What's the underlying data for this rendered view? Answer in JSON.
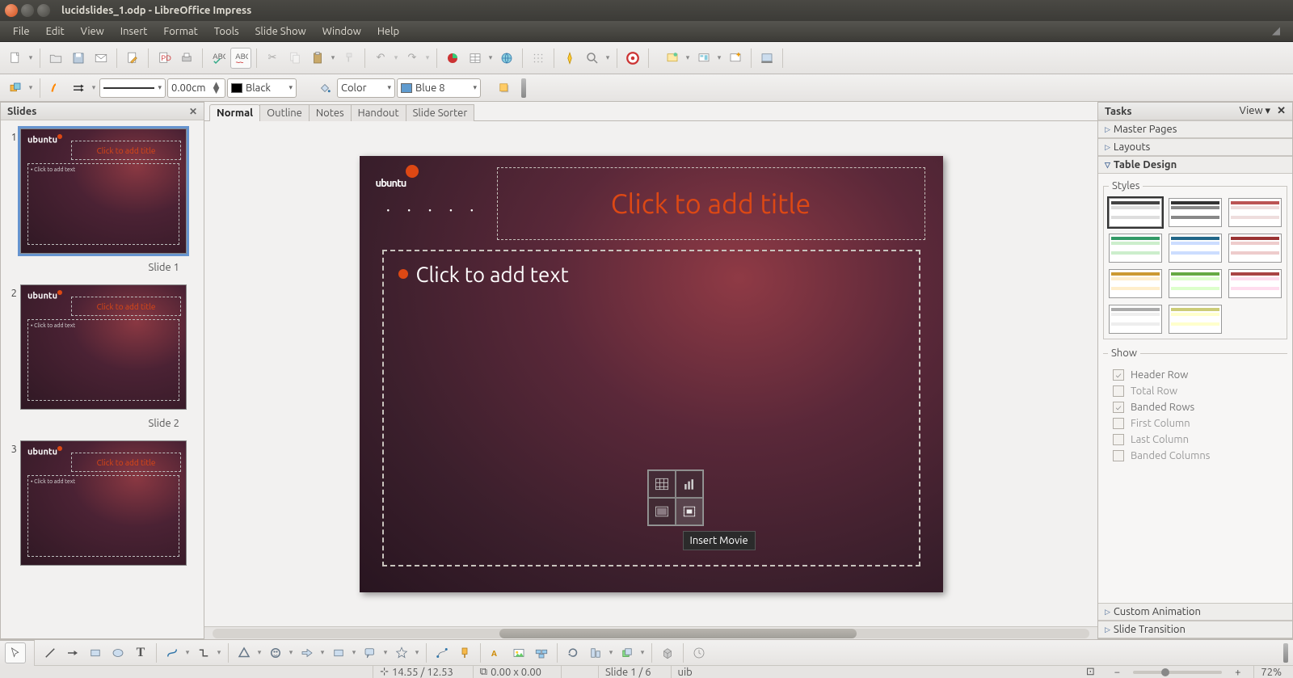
{
  "window": {
    "title": "lucidslides_1.odp - LibreOffice Impress"
  },
  "menu": [
    "File",
    "Edit",
    "View",
    "Insert",
    "Format",
    "Tools",
    "Slide Show",
    "Window",
    "Help"
  ],
  "fmt": {
    "width": "0.00cm",
    "linecolor": "Black",
    "fillmode": "Color",
    "fillcolor": "Blue 8"
  },
  "slides_panel": {
    "title": "Slides",
    "slides": [
      {
        "num": "1",
        "label": "Slide 1",
        "title": "Click to add title",
        "text": "Click to add text",
        "selected": true
      },
      {
        "num": "2",
        "label": "Slide 2",
        "title": "Click to add title",
        "text": "Click to add text",
        "selected": false
      },
      {
        "num": "3",
        "label": "",
        "title": "Click to add title",
        "text": "Click to add text",
        "selected": false
      }
    ]
  },
  "viewtabs": [
    "Normal",
    "Outline",
    "Notes",
    "Handout",
    "Slide Sorter"
  ],
  "slide": {
    "logo": "ubuntu",
    "title_ph": "Click to add title",
    "text_ph": "Click to add text",
    "tooltip": "Insert Movie"
  },
  "tasks": {
    "title": "Tasks",
    "view": "View",
    "sections": {
      "master": "Master Pages",
      "layouts": "Layouts",
      "table": "Table Design",
      "custom": "Custom Animation",
      "trans": "Slide Transition"
    },
    "styles_label": "Styles",
    "show_label": "Show",
    "show_opts": {
      "header": "Header Row",
      "total": "Total Row",
      "banded_rows": "Banded Rows",
      "first_col": "First Column",
      "last_col": "Last Column",
      "banded_cols": "Banded Columns"
    }
  },
  "status": {
    "coords": "14.55 / 12.53",
    "size": "0.00 x 0.00",
    "slide": "Slide 1 / 6",
    "theme": "uib",
    "zoom": "72%"
  }
}
